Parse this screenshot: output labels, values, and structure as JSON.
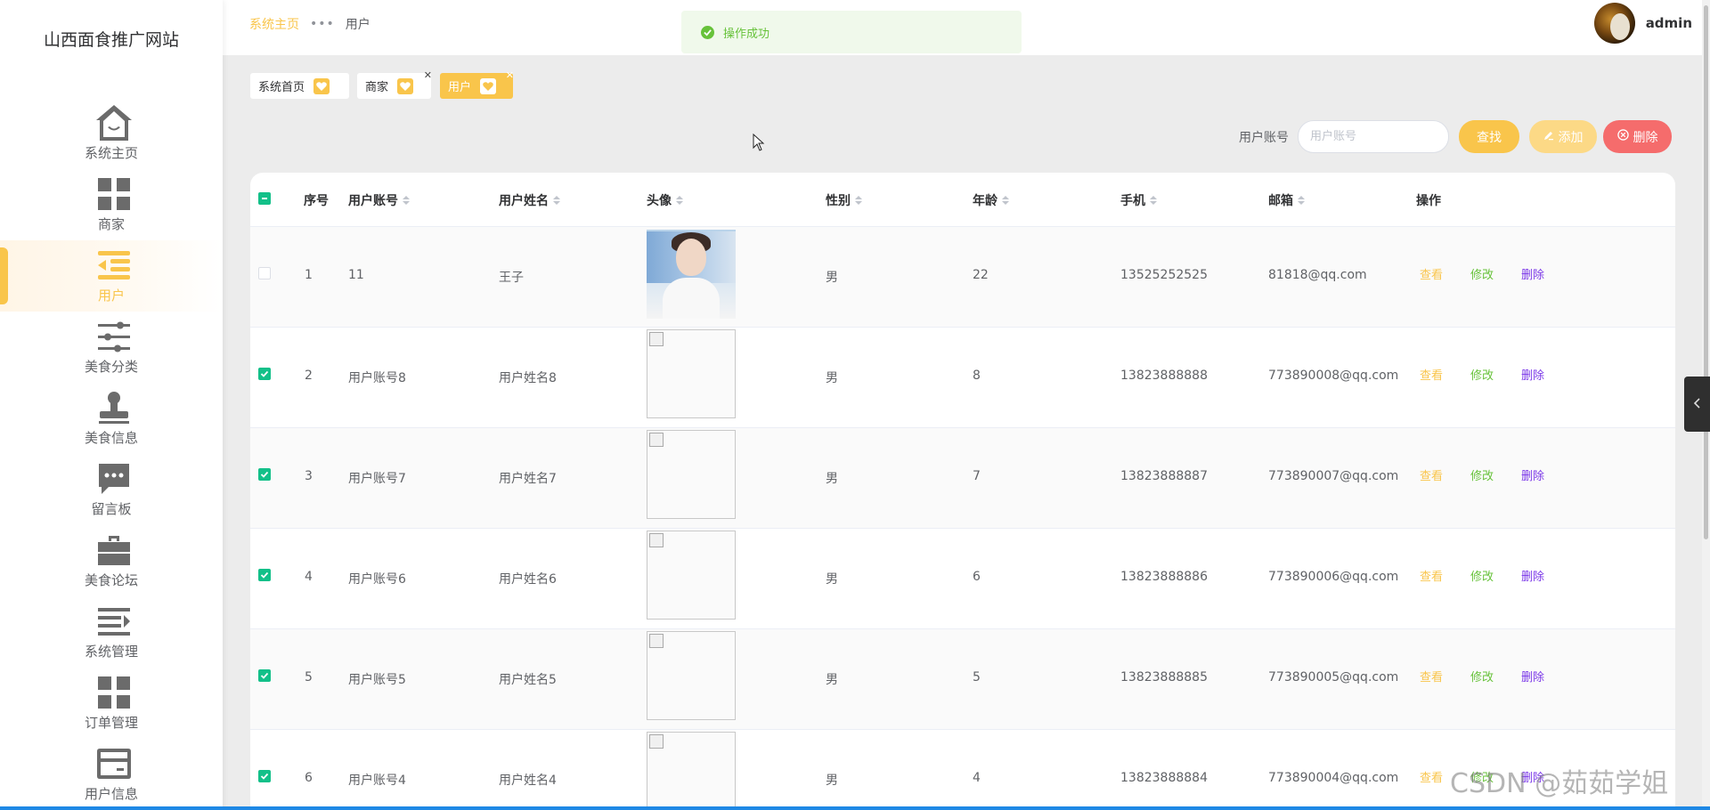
{
  "site": {
    "title": "山西面食推广网站"
  },
  "sidebar": {
    "items": [
      {
        "label": "系统主页",
        "icon": "home-icon"
      },
      {
        "label": "商家",
        "icon": "grid-icon"
      },
      {
        "label": "用户",
        "icon": "list-indent-icon",
        "active": true
      },
      {
        "label": "美食分类",
        "icon": "sliders-icon"
      },
      {
        "label": "美食信息",
        "icon": "stamp-icon"
      },
      {
        "label": "留言板",
        "icon": "chat-icon"
      },
      {
        "label": "美食论坛",
        "icon": "briefcase-icon"
      },
      {
        "label": "系统管理",
        "icon": "menu-icon"
      },
      {
        "label": "订单管理",
        "icon": "grid-icon"
      },
      {
        "label": "用户信息",
        "icon": "card-icon"
      }
    ]
  },
  "header": {
    "breadcrumb": {
      "home": "系统主页",
      "separator": "•••",
      "current": "用户"
    },
    "toast": "操作成功",
    "username": "admin"
  },
  "tags": [
    {
      "label": "系统首页",
      "closable": false,
      "active": false
    },
    {
      "label": "商家",
      "closable": true,
      "active": false
    },
    {
      "label": "用户",
      "closable": true,
      "active": true
    }
  ],
  "search": {
    "label": "用户账号",
    "placeholder": "用户账号",
    "value": "",
    "search_button": "查找",
    "add_button": "添加",
    "delete_button": "删除"
  },
  "table": {
    "columns": [
      "序号",
      "用户账号",
      "用户姓名",
      "头像",
      "性别",
      "年龄",
      "手机",
      "邮箱",
      "操作"
    ],
    "rows": [
      {
        "checked": false,
        "index": "1",
        "account": "11",
        "name": "王子",
        "avatar": "photo",
        "gender": "男",
        "age": "22",
        "phone": "13525252525",
        "email": "81818@qq.com"
      },
      {
        "checked": true,
        "index": "2",
        "account": "用户账号8",
        "name": "用户姓名8",
        "avatar": "broken",
        "gender": "男",
        "age": "8",
        "phone": "13823888888",
        "email": "773890008@qq.com"
      },
      {
        "checked": true,
        "index": "3",
        "account": "用户账号7",
        "name": "用户姓名7",
        "avatar": "broken",
        "gender": "男",
        "age": "7",
        "phone": "13823888887",
        "email": "773890007@qq.com"
      },
      {
        "checked": true,
        "index": "4",
        "account": "用户账号6",
        "name": "用户姓名6",
        "avatar": "broken",
        "gender": "男",
        "age": "6",
        "phone": "13823888886",
        "email": "773890006@qq.com"
      },
      {
        "checked": true,
        "index": "5",
        "account": "用户账号5",
        "name": "用户姓名5",
        "avatar": "broken",
        "gender": "男",
        "age": "5",
        "phone": "13823888885",
        "email": "773890005@qq.com"
      },
      {
        "checked": true,
        "index": "6",
        "account": "用户账号4",
        "name": "用户姓名4",
        "avatar": "broken",
        "gender": "男",
        "age": "4",
        "phone": "13823888884",
        "email": "773890004@qq.com"
      }
    ],
    "actions": {
      "view": "查看",
      "edit": "修改",
      "delete": "删除"
    }
  },
  "watermark": "CSDN @茹茹学姐",
  "colors": {
    "accent": "#f9c54b",
    "success": "#67c23a",
    "danger": "#f56c6c",
    "checkbox": "#13c089",
    "delete_link": "#7b38e8"
  }
}
